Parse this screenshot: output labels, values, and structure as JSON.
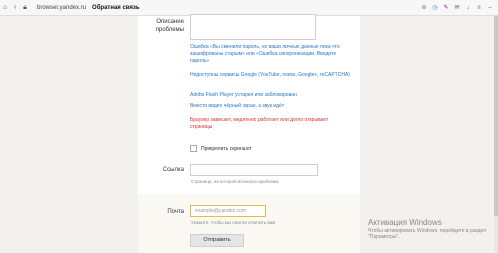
{
  "browser": {
    "domain": "browser.yandex.ru",
    "page_title": "Обратная связь",
    "nav": [
      "home-icon",
      "back-icon",
      "lock-icon"
    ],
    "right_icons": [
      "translate-icon",
      "clock-icon",
      "pen-icon",
      "chat-icon",
      "download-icon",
      "menu-icon",
      "minimize-icon"
    ]
  },
  "form": {
    "description_label": "Описание проблемы",
    "description_value": "",
    "options": [
      {
        "text": "Ошибка «Вы сменили пароль, но ваши личные данные пока что зашифрованы старым» или «Ошибка синхронизации. Введите пароль»",
        "kind": "link"
      },
      {
        "text": "Недоступны сервисы Google (YouTube, поиск, Google+, reCAPTCHA)",
        "kind": "link"
      },
      {
        "text": "Adobe Flash Player устарел или заблокирован",
        "kind": "link"
      },
      {
        "text": "Вместо видео чёрный экран, а звук идёт",
        "kind": "link"
      },
      {
        "text": "Браузер зависает, медленно работает или долго открывает страницы",
        "kind": "red"
      }
    ],
    "attach_label": "Прикрепить скриншот",
    "link_label": "Ссылка",
    "link_value": "",
    "link_hint": "Страница, на которой возникла проблема",
    "email_label": "Почта",
    "email_placeholder": "example@yandex.com",
    "email_hint": "Укажите, чтобы мы смогли ответить вам",
    "submit_label": "Отправить"
  },
  "watermark": {
    "title": "Активация Windows",
    "subtitle": "Чтобы активировать Windows, перейдите в раздел \"Параметры\"."
  }
}
